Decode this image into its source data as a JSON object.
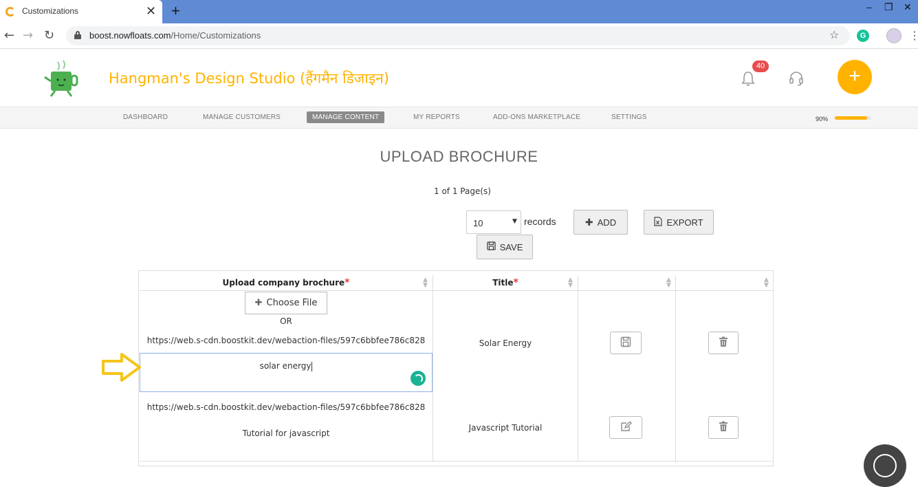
{
  "browser": {
    "tab_title": "Customizations",
    "close_glyph": "✕",
    "new_tab_glyph": "+",
    "url_domain": "boost.nowfloats.com",
    "url_path": "/Home/Customizations"
  },
  "header": {
    "business_name": "Hangman's Design Studio (हैंगमैन डिजाइन)",
    "notification_count": "40",
    "fab_glyph": "+"
  },
  "nav": {
    "items": [
      "DASHBOARD",
      "MANAGE CUSTOMERS",
      "MANAGE CONTENT",
      "MY REPORTS",
      "ADD-ONS MARKETPLACE",
      "SETTINGS"
    ],
    "active": "MANAGE CONTENT",
    "progress_label": "90%",
    "progress_value": 0.9
  },
  "page": {
    "title": "UPLOAD BROCHURE",
    "pager": "1 of 1 Page(s)",
    "records_select_value": "10",
    "records_label": "records",
    "add_label": "ADD",
    "export_label": "EXPORT",
    "save_label": "SAVE"
  },
  "table": {
    "columns": [
      "Upload company brochure",
      "Title"
    ],
    "required_mark": "*",
    "choose_file_label": "Choose File",
    "or_label": "OR",
    "rows": [
      {
        "url": "https://web.s-cdn.boostkit.dev/webaction-files/597c6bbfee786c828",
        "description_input": "solar energy",
        "title": "Solar Energy"
      },
      {
        "url": "https://web.s-cdn.boostkit.dev/webaction-files/597c6bbfee786c828",
        "description": "Tutorial for javascript",
        "title": "Javascript Tutorial"
      }
    ]
  },
  "colors": {
    "brand": "#ffb300",
    "badge": "#e84c4c",
    "spinner": "#1ab394",
    "tabbar": "#5f8ad4"
  }
}
